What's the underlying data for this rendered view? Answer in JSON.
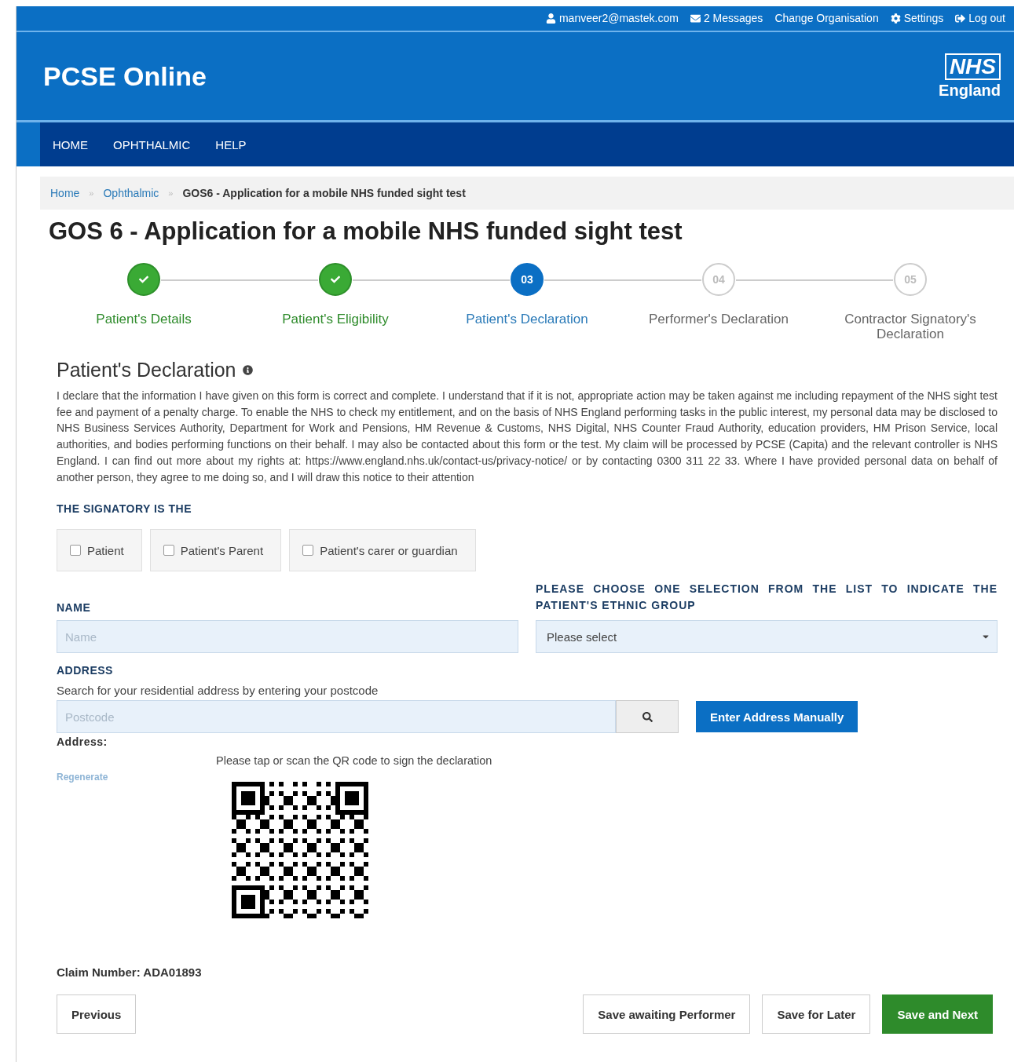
{
  "top_bar": {
    "items": [
      {
        "kind": "user",
        "label": "manveer2@mastek.com"
      },
      {
        "kind": "messages",
        "label": "2 Messages"
      },
      {
        "kind": "plain",
        "label": "Change Organisation"
      },
      {
        "kind": "settings",
        "label": "Settings"
      },
      {
        "kind": "logout",
        "label": "Log out"
      }
    ]
  },
  "header": {
    "title": "PCSE Online",
    "logo": {
      "mark": "NHS",
      "name": "England"
    }
  },
  "nav": {
    "items": [
      "HOME",
      "OPHTHALMIC",
      "HELP"
    ]
  },
  "breadcrumb": {
    "separator": "»",
    "links": [
      "Home",
      "Ophthalmic"
    ],
    "current": "GOS6 - Application for a mobile NHS funded sight test"
  },
  "page_title": "GOS 6 - Application for a mobile NHS funded sight test",
  "steps": [
    {
      "completed": true,
      "selected": false,
      "label": "Patient's Details"
    },
    {
      "completed": true,
      "selected": false,
      "label": "Patient's Eligibility"
    },
    {
      "completed": false,
      "selected": true,
      "number": "03",
      "label": "Patient's Declaration"
    },
    {
      "completed": false,
      "selected": false,
      "number": "04",
      "label": "Performer's Declaration"
    },
    {
      "completed": false,
      "selected": false,
      "number": "05",
      "label": "Contractor Signatory's Declaration"
    }
  ],
  "declaration": {
    "heading": "Patient's Declaration",
    "text": "I declare that the information I have given on this form is correct and complete. I understand that if it is not, appropriate action may be taken against me including repayment of the NHS sight test fee and payment of a penalty charge. To enable the NHS to check my entitlement, and on the basis of NHS England performing tasks in the public interest, my personal data may be disclosed to NHS Business Services Authority, Department for Work and Pensions, HM Revenue & Customs, NHS Digital, NHS Counter Fraud Authority, education providers, HM Prison Service, local authorities, and bodies performing functions on their behalf. I may also be contacted about this form or the test. My claim will be processed by PCSE (Capita) and the relevant controller is NHS England. I can find out more about my rights at: https://www.england.nhs.uk/contact-us/privacy-notice/ or by contacting 0300 311 22 33. Where I have provided personal data on behalf of another person, they agree to me doing so, and I will draw this notice to their attention"
  },
  "signatory": {
    "label": "THE SIGNATORY IS THE",
    "options": [
      {
        "label": "Patient",
        "checked": false
      },
      {
        "label": "Patient's Parent",
        "checked": false
      },
      {
        "label": "Patient's carer or guardian",
        "checked": false
      }
    ]
  },
  "name_field": {
    "label": "NAME",
    "placeholder": "Name"
  },
  "ethnic_field": {
    "label": "PLEASE CHOOSE ONE SELECTION FROM THE LIST TO INDICATE THE PATIENT'S ETHNIC GROUP",
    "value": "Please select"
  },
  "address": {
    "label": "ADDRESS",
    "hint": "Search for your residential address by entering your postcode",
    "placeholder": "Postcode",
    "manual_button": "Enter Address Manually",
    "result_label": "Address:"
  },
  "qr": {
    "instruction": "Please tap or scan the QR code to sign the declaration",
    "regenerate": "Regenerate"
  },
  "claim_number": "Claim Number: ADA01893",
  "buttons": {
    "previous": "Previous",
    "actions": [
      {
        "kind": "secondary",
        "label": "Save awaiting Performer"
      },
      {
        "kind": "secondary",
        "label": "Save for Later"
      },
      {
        "kind": "primary",
        "label": "Save and Next"
      }
    ]
  }
}
